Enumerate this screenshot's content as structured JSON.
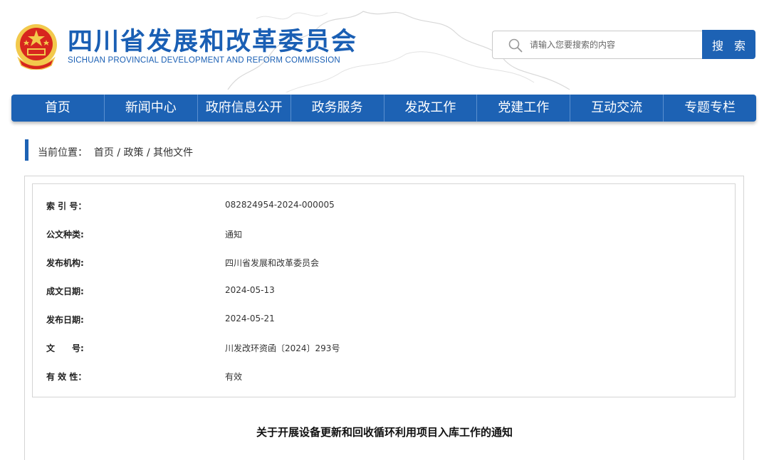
{
  "header": {
    "title": "四川省发展和改革委员会",
    "subtitle": "SICHUAN PROVINCIAL DEVELOPMENT AND REFORM COMMISSION"
  },
  "search": {
    "placeholder": "请输入您要搜索的内容",
    "button_label": "搜 索"
  },
  "nav": {
    "items": [
      "首页",
      "新闻中心",
      "政府信息公开",
      "政务服务",
      "发改工作",
      "党建工作",
      "互动交流",
      "专题专栏"
    ]
  },
  "breadcrumb": {
    "prefix": "当前位置：",
    "items": [
      "首页",
      "政策",
      "其他文件"
    ],
    "separator": " / "
  },
  "meta": {
    "rows": [
      {
        "label": "索 引 号：",
        "value": "082824954-2024-000005"
      },
      {
        "label": "公文种类:",
        "value": "通知"
      },
      {
        "label": "发布机构:",
        "value": "四川省发展和改革委员会"
      },
      {
        "label": "成文日期:",
        "value": "2024-05-13"
      },
      {
        "label": "发布日期:",
        "value": "2024-05-21"
      },
      {
        "label": "文　　号:",
        "value": "川发改环资函〔2024〕293号"
      },
      {
        "label": "有 效 性：",
        "value": "有效"
      }
    ]
  },
  "document": {
    "title": "关于开展设备更新和回收循环利用项目入库工作的通知"
  },
  "colors": {
    "primary": "#1d62b4",
    "emblem_red": "#d7261e",
    "emblem_gold": "#f2c94c"
  }
}
